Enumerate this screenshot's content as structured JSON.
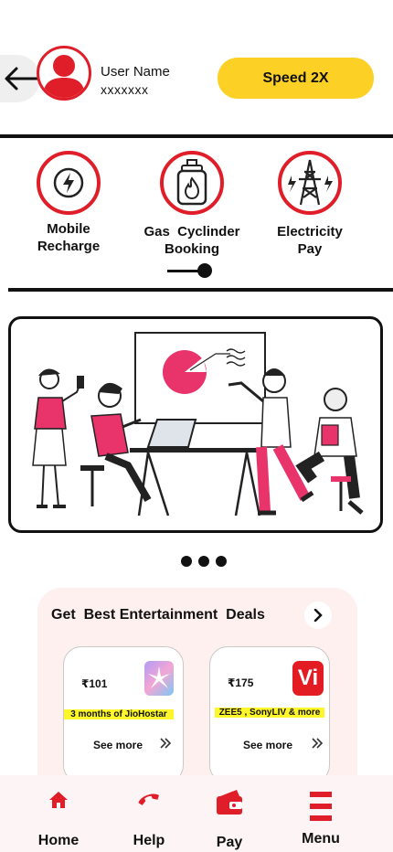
{
  "header": {
    "user_name": "User Name",
    "user_id": "xxxxxxx",
    "speed_button": "Speed 2X",
    "icons": {
      "back": "arrow-left-icon",
      "avatar": "user-avatar-icon"
    }
  },
  "services": [
    {
      "line1": "Mobile",
      "line2": "Recharge",
      "icon": "lightning-bolt-icon"
    },
    {
      "line1": "Gas  Cyclinder",
      "line2": "Booking",
      "icon": "gas-cylinder-icon"
    },
    {
      "line1": "Electricity",
      "line2": "Pay",
      "icon": "power-tower-icon"
    }
  ],
  "banner": {
    "illustration": "team-meeting-illustration",
    "page_count": 3
  },
  "deals": {
    "title": "Get  Best Entertainment  Deals",
    "offers": [
      {
        "price": "₹101",
        "tag": "3 months of JioHostar",
        "see_more": "See more",
        "logo": "jiohotstar-logo-icon"
      },
      {
        "price": "₹175",
        "tag": "ZEE5 , SonyLIV & more",
        "see_more": "See more",
        "logo": "vi-logo-icon",
        "logo_text": "Vi"
      }
    ]
  },
  "bottom_nav": [
    {
      "label": "Home",
      "icon": "home-icon"
    },
    {
      "label": "Help",
      "icon": "phone-icon"
    },
    {
      "label": "Pay",
      "icon": "wallet-card-icon"
    },
    {
      "label": "Menu",
      "icon": "hamburger-menu-icon"
    }
  ],
  "colors": {
    "accent": "#e01e2a",
    "button": "#fcd024",
    "tag": "#fdf62a",
    "deals_bg": "#fdf0ef"
  }
}
